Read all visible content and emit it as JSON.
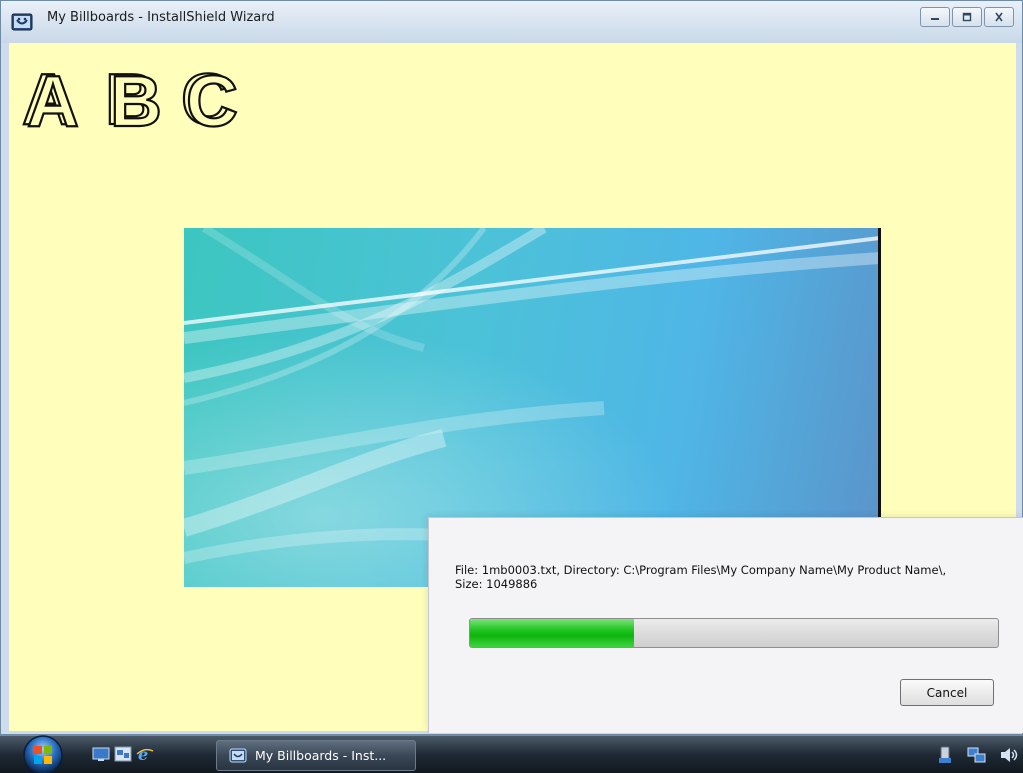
{
  "window": {
    "title": "My Billboards - InstallShield Wizard",
    "controls": [
      "minimize",
      "maximize",
      "close"
    ]
  },
  "billboard": {
    "background_color": "#ffffbb",
    "logo_letters": "A B C",
    "image_icon": "teal-aurora-wallpaper"
  },
  "progress": {
    "status_line": "File: 1mb0003.txt,  Directory: C:\\Program Files\\My Company Name\\My Product Name\\,\n Size: 1049886",
    "fraction": 0.31,
    "fill_color": "#1ec41e",
    "cancel_label": "Cancel"
  },
  "taskbar": {
    "start_icon": "windows-orb-icon",
    "quick_launch": [
      "show-desktop-icon",
      "switch-windows-icon",
      "internet-explorer-icon"
    ],
    "task_label": "My Billboards - Inst...",
    "tray_icons": [
      "safely-remove-icon",
      "network-icon",
      "volume-icon"
    ]
  }
}
